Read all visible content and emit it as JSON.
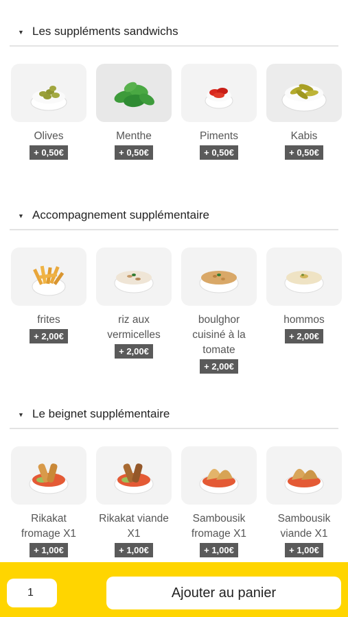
{
  "sections": [
    {
      "title": "Les suppléments sandwichs",
      "items": [
        {
          "name": "Olives",
          "price": "+ 0,50€",
          "icon": "olives-bowl-icon"
        },
        {
          "name": "Menthe",
          "price": "+ 0,50€",
          "icon": "mint-leaves-icon"
        },
        {
          "name": "Piments",
          "price": "+ 0,50€",
          "icon": "chili-peppers-bowl-icon"
        },
        {
          "name": "Kabis",
          "price": "+ 0,50€",
          "icon": "pickles-bowl-icon"
        }
      ]
    },
    {
      "title": "Accompagnement supplémentaire",
      "items": [
        {
          "name": "frites",
          "price": "+ 2,00€",
          "icon": "fries-bowl-icon"
        },
        {
          "name": "riz aux vermicelles",
          "price": "+ 2,00€",
          "icon": "rice-bowl-icon"
        },
        {
          "name": "boulghor cuisiné à la tomate",
          "price": "+ 2,00€",
          "icon": "bulgur-bowl-icon"
        },
        {
          "name": "hommos",
          "price": "+ 2,00€",
          "icon": "hummus-bowl-icon"
        }
      ]
    },
    {
      "title": "Le beignet supplémentaire",
      "items": [
        {
          "name": "Rikakat fromage X1",
          "price": "+ 1,00€",
          "icon": "rikakat-bowl-icon"
        },
        {
          "name": "Rikakat viande X1",
          "price": "+ 1,00€",
          "icon": "rikakat-bowl-icon"
        },
        {
          "name": "Sambousik fromage X1",
          "price": "+ 1,00€",
          "icon": "sambousik-bowl-icon"
        },
        {
          "name": "Sambousik viande X1",
          "price": "+ 1,00€",
          "icon": "sambousik-bowl-icon"
        }
      ]
    }
  ],
  "footer": {
    "quantity": "1",
    "add_label": "Ajouter au panier",
    "accent_color": "#ffd500"
  }
}
